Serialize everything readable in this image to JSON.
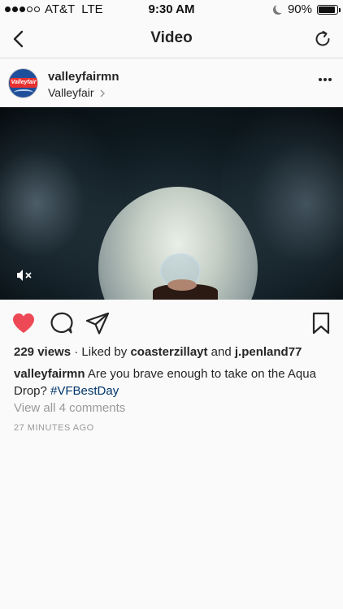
{
  "status_bar": {
    "carrier": "AT&T",
    "network": "LTE",
    "time": "9:30 AM",
    "battery": "90%",
    "battery_level": 0.9
  },
  "nav": {
    "title": "Video",
    "back_icon": "chevron-left-icon",
    "refresh_icon": "refresh-icon"
  },
  "post": {
    "username": "valleyfairmn",
    "location": "Valleyfair",
    "location_chevron": ">",
    "avatar_text": "Valleyfair"
  },
  "actions": {
    "liked": true,
    "like_color": "#ed4956"
  },
  "engagement": {
    "views": "229 views",
    "separator": " · ",
    "liked_by_prefix": "Liked by ",
    "liked_by_user1": "coasterzillayt",
    "liked_by_and": " and ",
    "liked_by_user2": "j.penland77"
  },
  "caption": {
    "username": "valleyfairmn",
    "text": " Are you brave enough to take on the Aqua Drop? ",
    "hashtag": "#VFBestDay"
  },
  "comments_link": "View all 4 comments",
  "timestamp": "27 MINUTES AGO"
}
